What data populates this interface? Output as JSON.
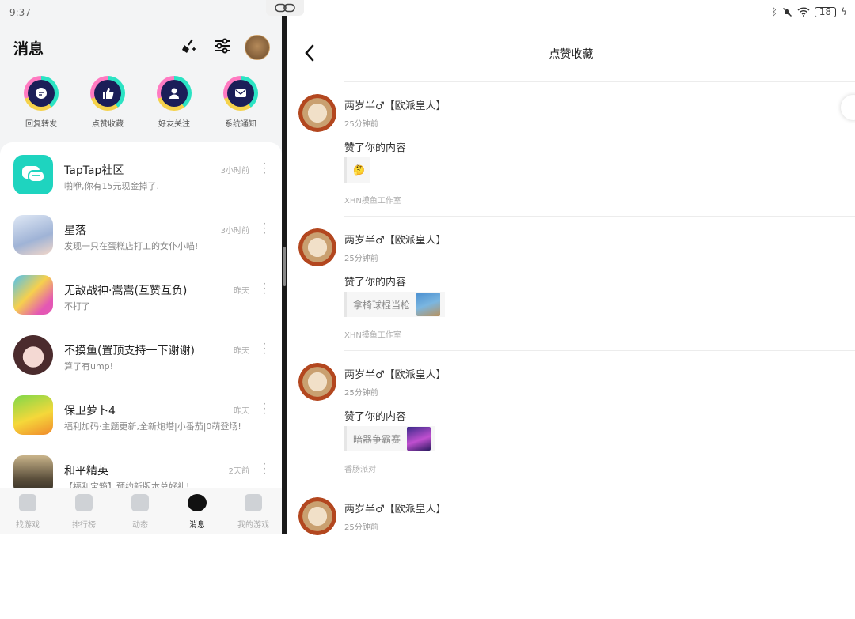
{
  "status": {
    "time": "9:37",
    "battery": "18"
  },
  "left": {
    "title": "消息",
    "quick": [
      {
        "label": "回复转发",
        "icon": "chat-bubble-icon"
      },
      {
        "label": "点赞收藏",
        "icon": "thumbs-up-icon"
      },
      {
        "label": "好友关注",
        "icon": "person-icon"
      },
      {
        "label": "系统通知",
        "icon": "envelope-icon"
      }
    ],
    "rows": [
      {
        "name": "TapTap社区",
        "preview": "啪咿,你有15元现金掉了.",
        "time": "3小时前"
      },
      {
        "name": "星落",
        "preview": "发现一只在蛋糕店打工的女仆小喵!",
        "time": "3小时前"
      },
      {
        "name": "无敌战神·嵩嵩(互赞互负)",
        "preview": "不打了",
        "time": "昨天"
      },
      {
        "name": "不摸鱼(置顶支持一下谢谢)",
        "preview": "算了有ump!",
        "time": "昨天"
      },
      {
        "name": "保卫萝卜4",
        "preview": "福利加码·主题更新,全新炮塔|小番茄|0萌登场!",
        "time": "昨天"
      },
      {
        "name": "和平精英",
        "preview": "【福利宝箱】预约新版本兑好礼!",
        "time": "2天前"
      }
    ],
    "nav": [
      {
        "label": "找游戏"
      },
      {
        "label": "排行榜"
      },
      {
        "label": "动态"
      },
      {
        "label": "消息"
      },
      {
        "label": "我的游戏"
      }
    ]
  },
  "right": {
    "title": "点赞收藏",
    "items": [
      {
        "user": "两岁半♂【欧派皇人】",
        "time": "25分钟前",
        "action": "赞了你的内容",
        "quote": "🤔",
        "source": "XHN摸鱼工作室"
      },
      {
        "user": "两岁半♂【欧派皇人】",
        "time": "25分钟前",
        "action": "赞了你的内容",
        "quote": "拿椅球棍当枪",
        "source": "XHN摸鱼工作室"
      },
      {
        "user": "两岁半♂【欧派皇人】",
        "time": "25分钟前",
        "action": "赞了你的内容",
        "quote": "暗器争霸赛",
        "source": "香肠派对"
      },
      {
        "user": "两岁半♂【欧派皇人】",
        "time": "25分钟前",
        "action": "",
        "quote": "",
        "source": ""
      }
    ]
  }
}
